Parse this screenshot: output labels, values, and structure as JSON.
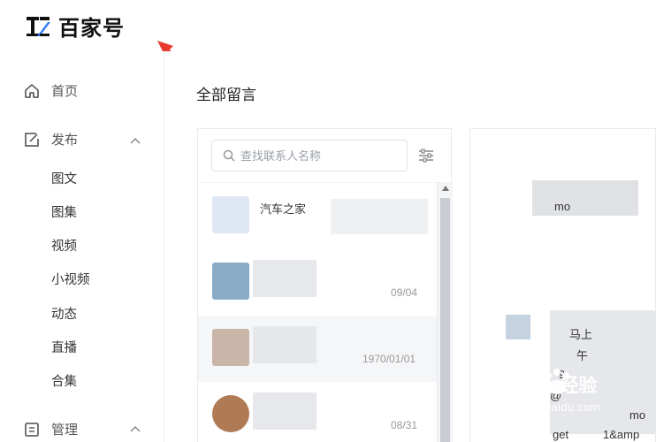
{
  "brand": {
    "name": "百家号"
  },
  "sidebar": {
    "home": "首页",
    "publish": "发布",
    "publish_items": [
      "图文",
      "图集",
      "视频",
      "小视频",
      "动态",
      "直播",
      "合集"
    ],
    "manage": "管理"
  },
  "main": {
    "title": "全部留言"
  },
  "contacts": {
    "search_placeholder": "查找联系人名称",
    "rows": [
      {
        "name": "汽车之家",
        "date": ""
      },
      {
        "name": "",
        "date": "09/04"
      },
      {
        "name": "",
        "date": "1970/01/01"
      },
      {
        "name": "",
        "date": "08/31"
      }
    ]
  },
  "detail": {
    "lines": [
      "mo",
      "马上",
      "午",
      "9",
      "@",
      "mo",
      "get",
      "1&amp"
    ]
  },
  "watermark": {
    "brand": "Baidu经验",
    "url": "jingyan.baidu.com"
  },
  "colors": {
    "accent": "#2d7cf6",
    "annotation": "#e83a2f",
    "brand_dark": "#111111"
  }
}
